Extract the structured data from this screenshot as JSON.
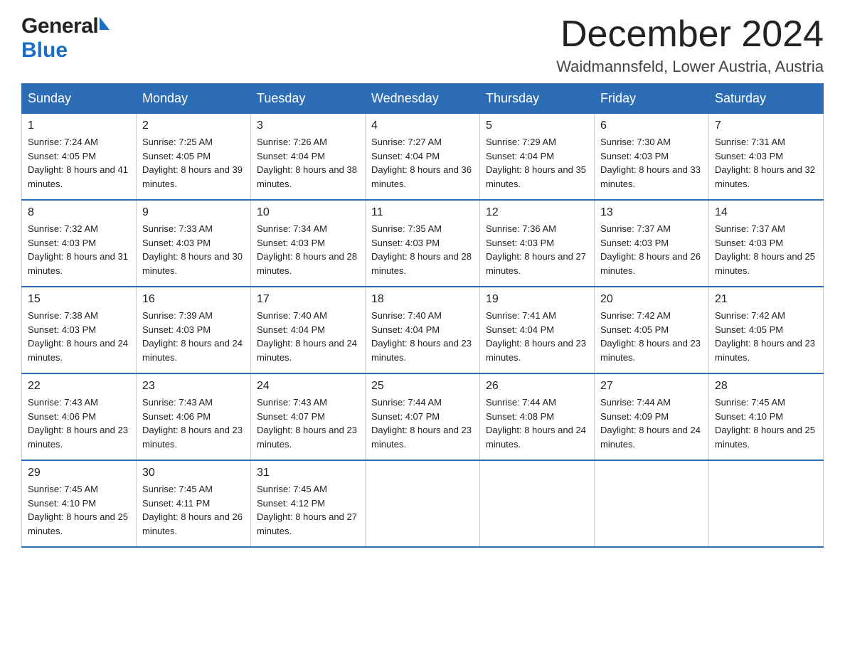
{
  "header": {
    "logo": {
      "general": "General",
      "blue": "Blue"
    },
    "month_title": "December 2024",
    "location": "Waidmannsfeld, Lower Austria, Austria"
  },
  "weekdays": [
    "Sunday",
    "Monday",
    "Tuesday",
    "Wednesday",
    "Thursday",
    "Friday",
    "Saturday"
  ],
  "weeks": [
    [
      {
        "day": "1",
        "sunrise": "7:24 AM",
        "sunset": "4:05 PM",
        "daylight": "8 hours and 41 minutes."
      },
      {
        "day": "2",
        "sunrise": "7:25 AM",
        "sunset": "4:05 PM",
        "daylight": "8 hours and 39 minutes."
      },
      {
        "day": "3",
        "sunrise": "7:26 AM",
        "sunset": "4:04 PM",
        "daylight": "8 hours and 38 minutes."
      },
      {
        "day": "4",
        "sunrise": "7:27 AM",
        "sunset": "4:04 PM",
        "daylight": "8 hours and 36 minutes."
      },
      {
        "day": "5",
        "sunrise": "7:29 AM",
        "sunset": "4:04 PM",
        "daylight": "8 hours and 35 minutes."
      },
      {
        "day": "6",
        "sunrise": "7:30 AM",
        "sunset": "4:03 PM",
        "daylight": "8 hours and 33 minutes."
      },
      {
        "day": "7",
        "sunrise": "7:31 AM",
        "sunset": "4:03 PM",
        "daylight": "8 hours and 32 minutes."
      }
    ],
    [
      {
        "day": "8",
        "sunrise": "7:32 AM",
        "sunset": "4:03 PM",
        "daylight": "8 hours and 31 minutes."
      },
      {
        "day": "9",
        "sunrise": "7:33 AM",
        "sunset": "4:03 PM",
        "daylight": "8 hours and 30 minutes."
      },
      {
        "day": "10",
        "sunrise": "7:34 AM",
        "sunset": "4:03 PM",
        "daylight": "8 hours and 28 minutes."
      },
      {
        "day": "11",
        "sunrise": "7:35 AM",
        "sunset": "4:03 PM",
        "daylight": "8 hours and 28 minutes."
      },
      {
        "day": "12",
        "sunrise": "7:36 AM",
        "sunset": "4:03 PM",
        "daylight": "8 hours and 27 minutes."
      },
      {
        "day": "13",
        "sunrise": "7:37 AM",
        "sunset": "4:03 PM",
        "daylight": "8 hours and 26 minutes."
      },
      {
        "day": "14",
        "sunrise": "7:37 AM",
        "sunset": "4:03 PM",
        "daylight": "8 hours and 25 minutes."
      }
    ],
    [
      {
        "day": "15",
        "sunrise": "7:38 AM",
        "sunset": "4:03 PM",
        "daylight": "8 hours and 24 minutes."
      },
      {
        "day": "16",
        "sunrise": "7:39 AM",
        "sunset": "4:03 PM",
        "daylight": "8 hours and 24 minutes."
      },
      {
        "day": "17",
        "sunrise": "7:40 AM",
        "sunset": "4:04 PM",
        "daylight": "8 hours and 24 minutes."
      },
      {
        "day": "18",
        "sunrise": "7:40 AM",
        "sunset": "4:04 PM",
        "daylight": "8 hours and 23 minutes."
      },
      {
        "day": "19",
        "sunrise": "7:41 AM",
        "sunset": "4:04 PM",
        "daylight": "8 hours and 23 minutes."
      },
      {
        "day": "20",
        "sunrise": "7:42 AM",
        "sunset": "4:05 PM",
        "daylight": "8 hours and 23 minutes."
      },
      {
        "day": "21",
        "sunrise": "7:42 AM",
        "sunset": "4:05 PM",
        "daylight": "8 hours and 23 minutes."
      }
    ],
    [
      {
        "day": "22",
        "sunrise": "7:43 AM",
        "sunset": "4:06 PM",
        "daylight": "8 hours and 23 minutes."
      },
      {
        "day": "23",
        "sunrise": "7:43 AM",
        "sunset": "4:06 PM",
        "daylight": "8 hours and 23 minutes."
      },
      {
        "day": "24",
        "sunrise": "7:43 AM",
        "sunset": "4:07 PM",
        "daylight": "8 hours and 23 minutes."
      },
      {
        "day": "25",
        "sunrise": "7:44 AM",
        "sunset": "4:07 PM",
        "daylight": "8 hours and 23 minutes."
      },
      {
        "day": "26",
        "sunrise": "7:44 AM",
        "sunset": "4:08 PM",
        "daylight": "8 hours and 24 minutes."
      },
      {
        "day": "27",
        "sunrise": "7:44 AM",
        "sunset": "4:09 PM",
        "daylight": "8 hours and 24 minutes."
      },
      {
        "day": "28",
        "sunrise": "7:45 AM",
        "sunset": "4:10 PM",
        "daylight": "8 hours and 25 minutes."
      }
    ],
    [
      {
        "day": "29",
        "sunrise": "7:45 AM",
        "sunset": "4:10 PM",
        "daylight": "8 hours and 25 minutes."
      },
      {
        "day": "30",
        "sunrise": "7:45 AM",
        "sunset": "4:11 PM",
        "daylight": "8 hours and 26 minutes."
      },
      {
        "day": "31",
        "sunrise": "7:45 AM",
        "sunset": "4:12 PM",
        "daylight": "8 hours and 27 minutes."
      },
      null,
      null,
      null,
      null
    ]
  ],
  "labels": {
    "sunrise": "Sunrise:",
    "sunset": "Sunset:",
    "daylight": "Daylight:"
  }
}
